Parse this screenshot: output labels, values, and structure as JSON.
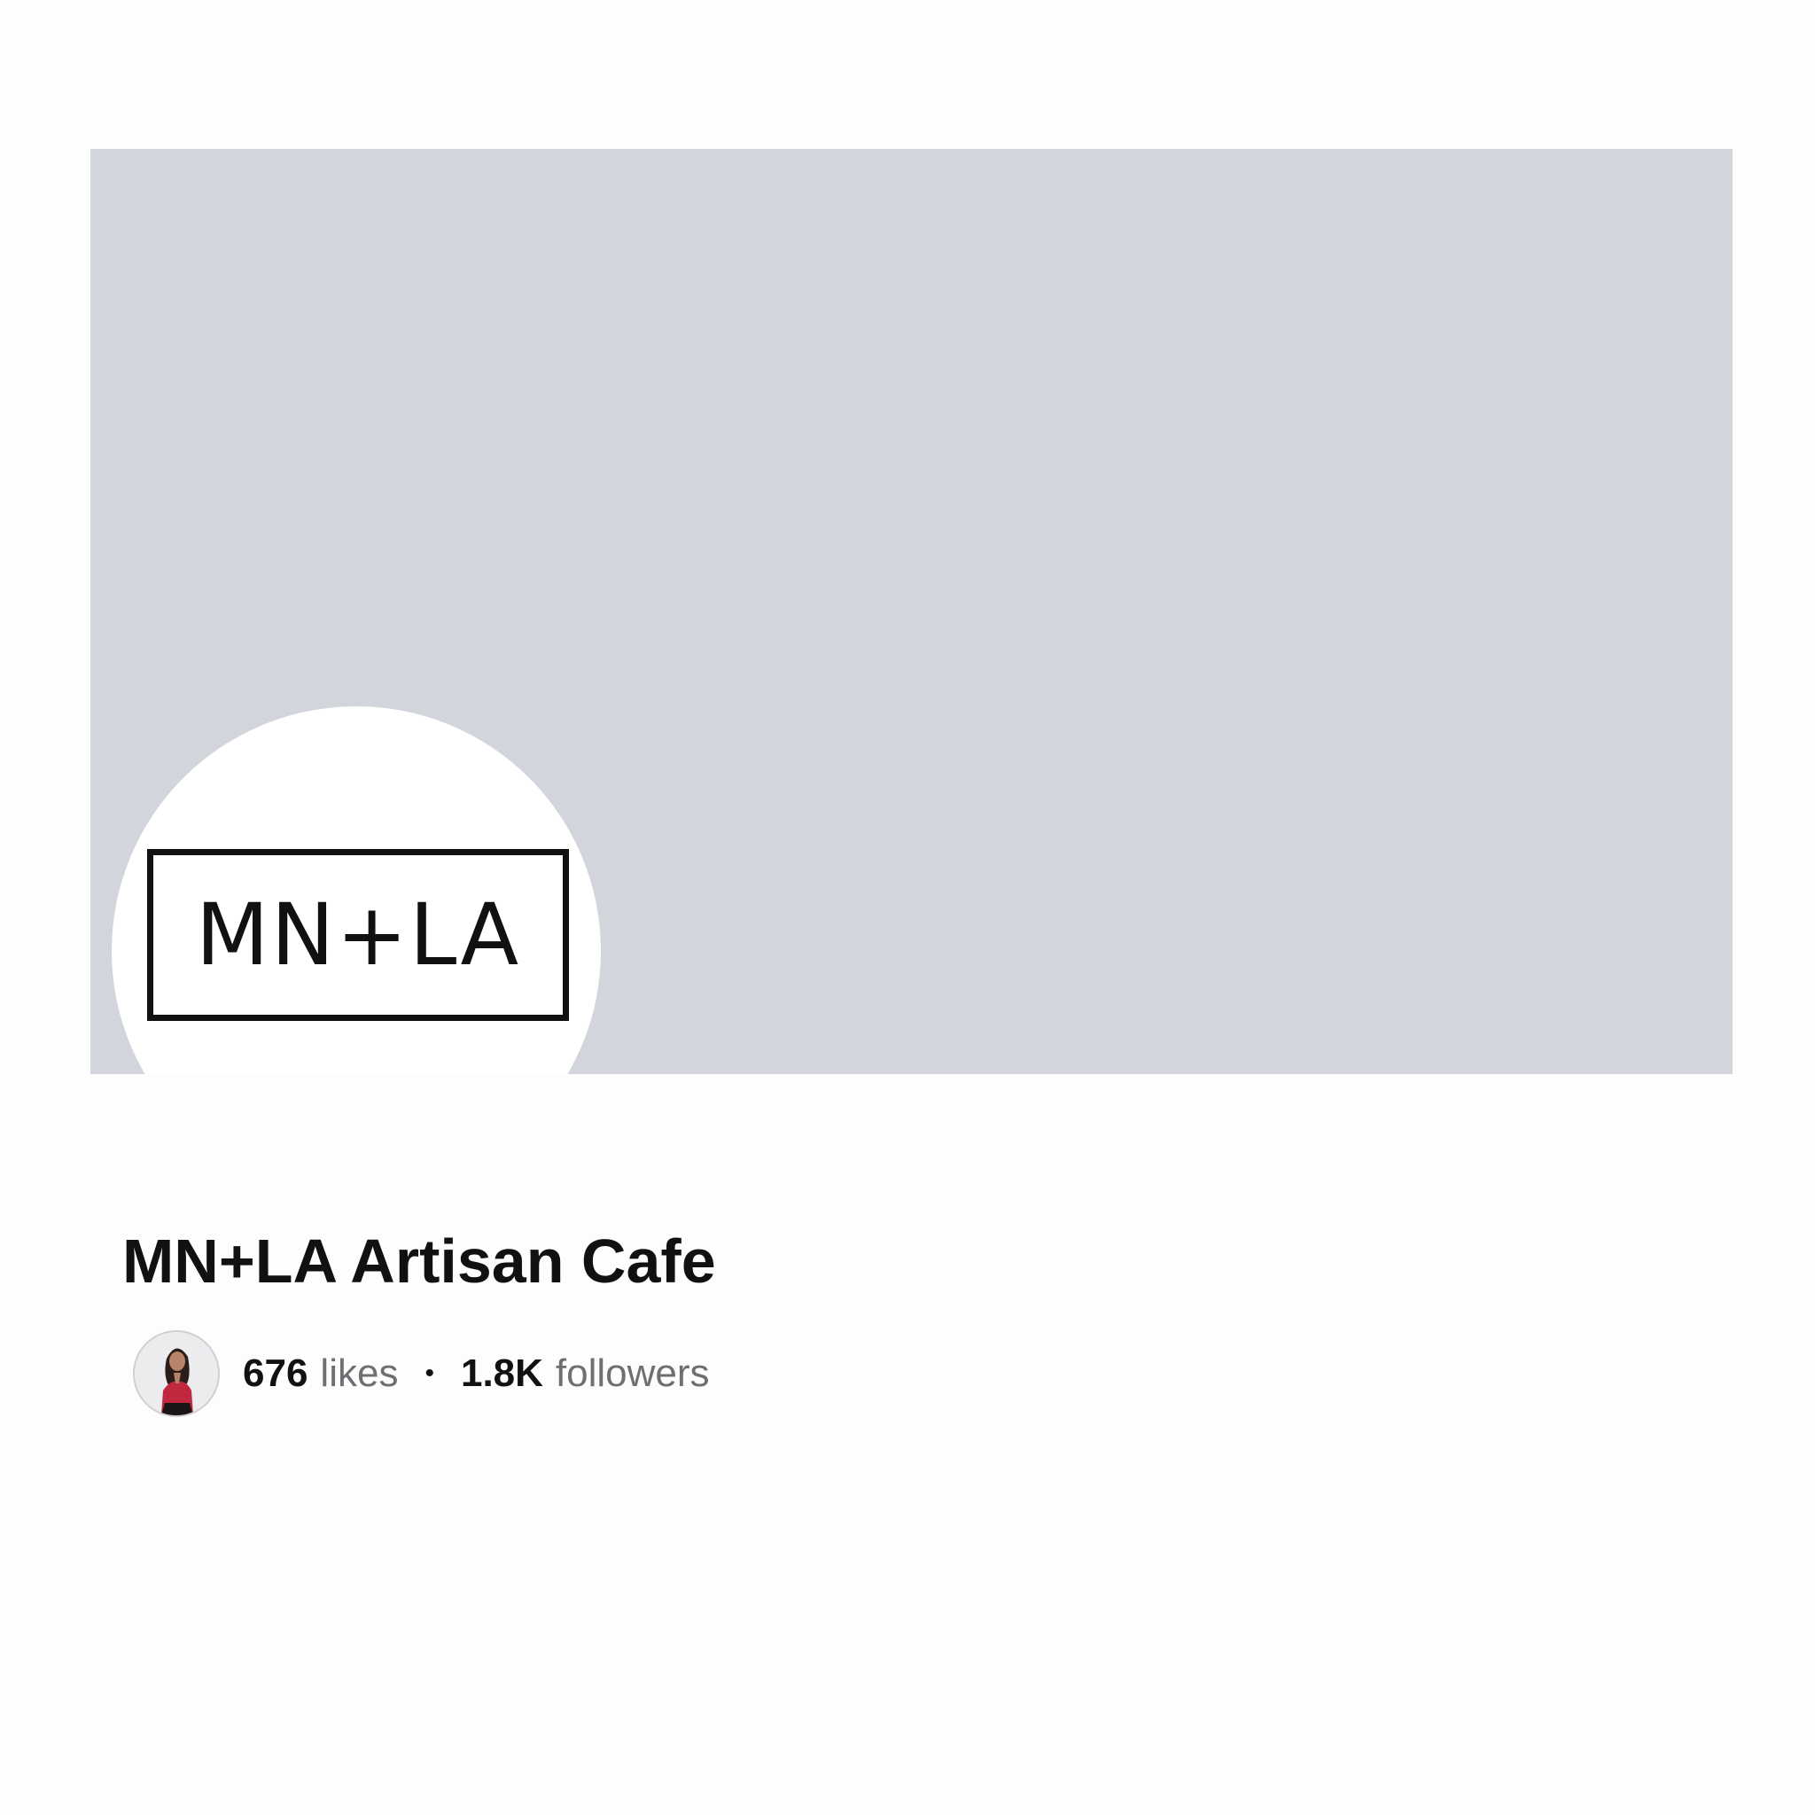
{
  "colors": {
    "background": "#fdfdfd",
    "cover": "#d2d5dc",
    "text_primary": "#111111",
    "text_secondary": "#6f6f73",
    "avatar_dress": "#c0283e"
  },
  "cover": {
    "logo_text": "MN+LA"
  },
  "page": {
    "title": "MN+LA Artisan Cafe"
  },
  "stats": {
    "avatar_icon": "user-avatar",
    "likes_count": "676",
    "likes_label": "likes",
    "separator": "•",
    "followers_count": "1.8K",
    "followers_label": "followers"
  }
}
